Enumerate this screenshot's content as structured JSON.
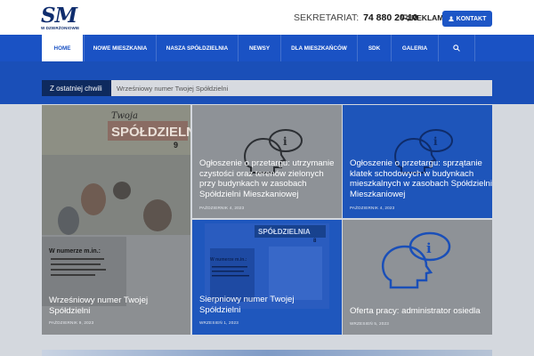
{
  "header": {
    "logo_text": "SM",
    "logo_subtitle": "W DZIERŻONIOWIE",
    "sekretariat_label": "SEKRETARIAT:",
    "phone": "74 880 20 10",
    "reklama_label": "REKLAMA",
    "kontakt_label": "KONTAKT"
  },
  "nav": {
    "items": [
      {
        "label": "HOME"
      },
      {
        "label": "NOWE MIESZKANIA"
      },
      {
        "label": "NASZA SPÓŁDZIELNIA"
      },
      {
        "label": "NEWSY"
      },
      {
        "label": "DLA MIESZKAŃCÓW"
      },
      {
        "label": "SDK"
      },
      {
        "label": "GALERIA"
      }
    ]
  },
  "ticker": {
    "label": "Z ostatniej chwili",
    "text": "Wrześniowy numer Twojej Spółdzielni"
  },
  "posts": [
    {
      "title": "Wrześniowy numer Twojej Spółdzielni",
      "date": "PAŹDZIERNIK 9, 2023"
    },
    {
      "title": "Ogłoszenie o przetargu: utrzymanie czystości oraz terenów zielonych przy budynkach w zasobach Spółdzielni Mieszkaniowej",
      "date": "PAŹDZIERNIK 4, 2023"
    },
    {
      "title": "Ogłoszenie o przetargu: sprzątanie klatek schodowych w budynkach mieszkalnych w zasobach Spółdzielni Mieszkaniowej",
      "date": "PAŹDZIERNIK 4, 2023"
    },
    {
      "title": "Sierpniowy numer Twojej Spółdzielni",
      "date": "WRZESIEŃ 1, 2023"
    },
    {
      "title": "Oferta pracy: administrator osiedla",
      "date": "WRZESIEŃ 5, 2023"
    }
  ],
  "colors": {
    "accent": "#1a52c4",
    "dark_navy": "#0e2a5e",
    "card_grey": "#8e9297"
  }
}
